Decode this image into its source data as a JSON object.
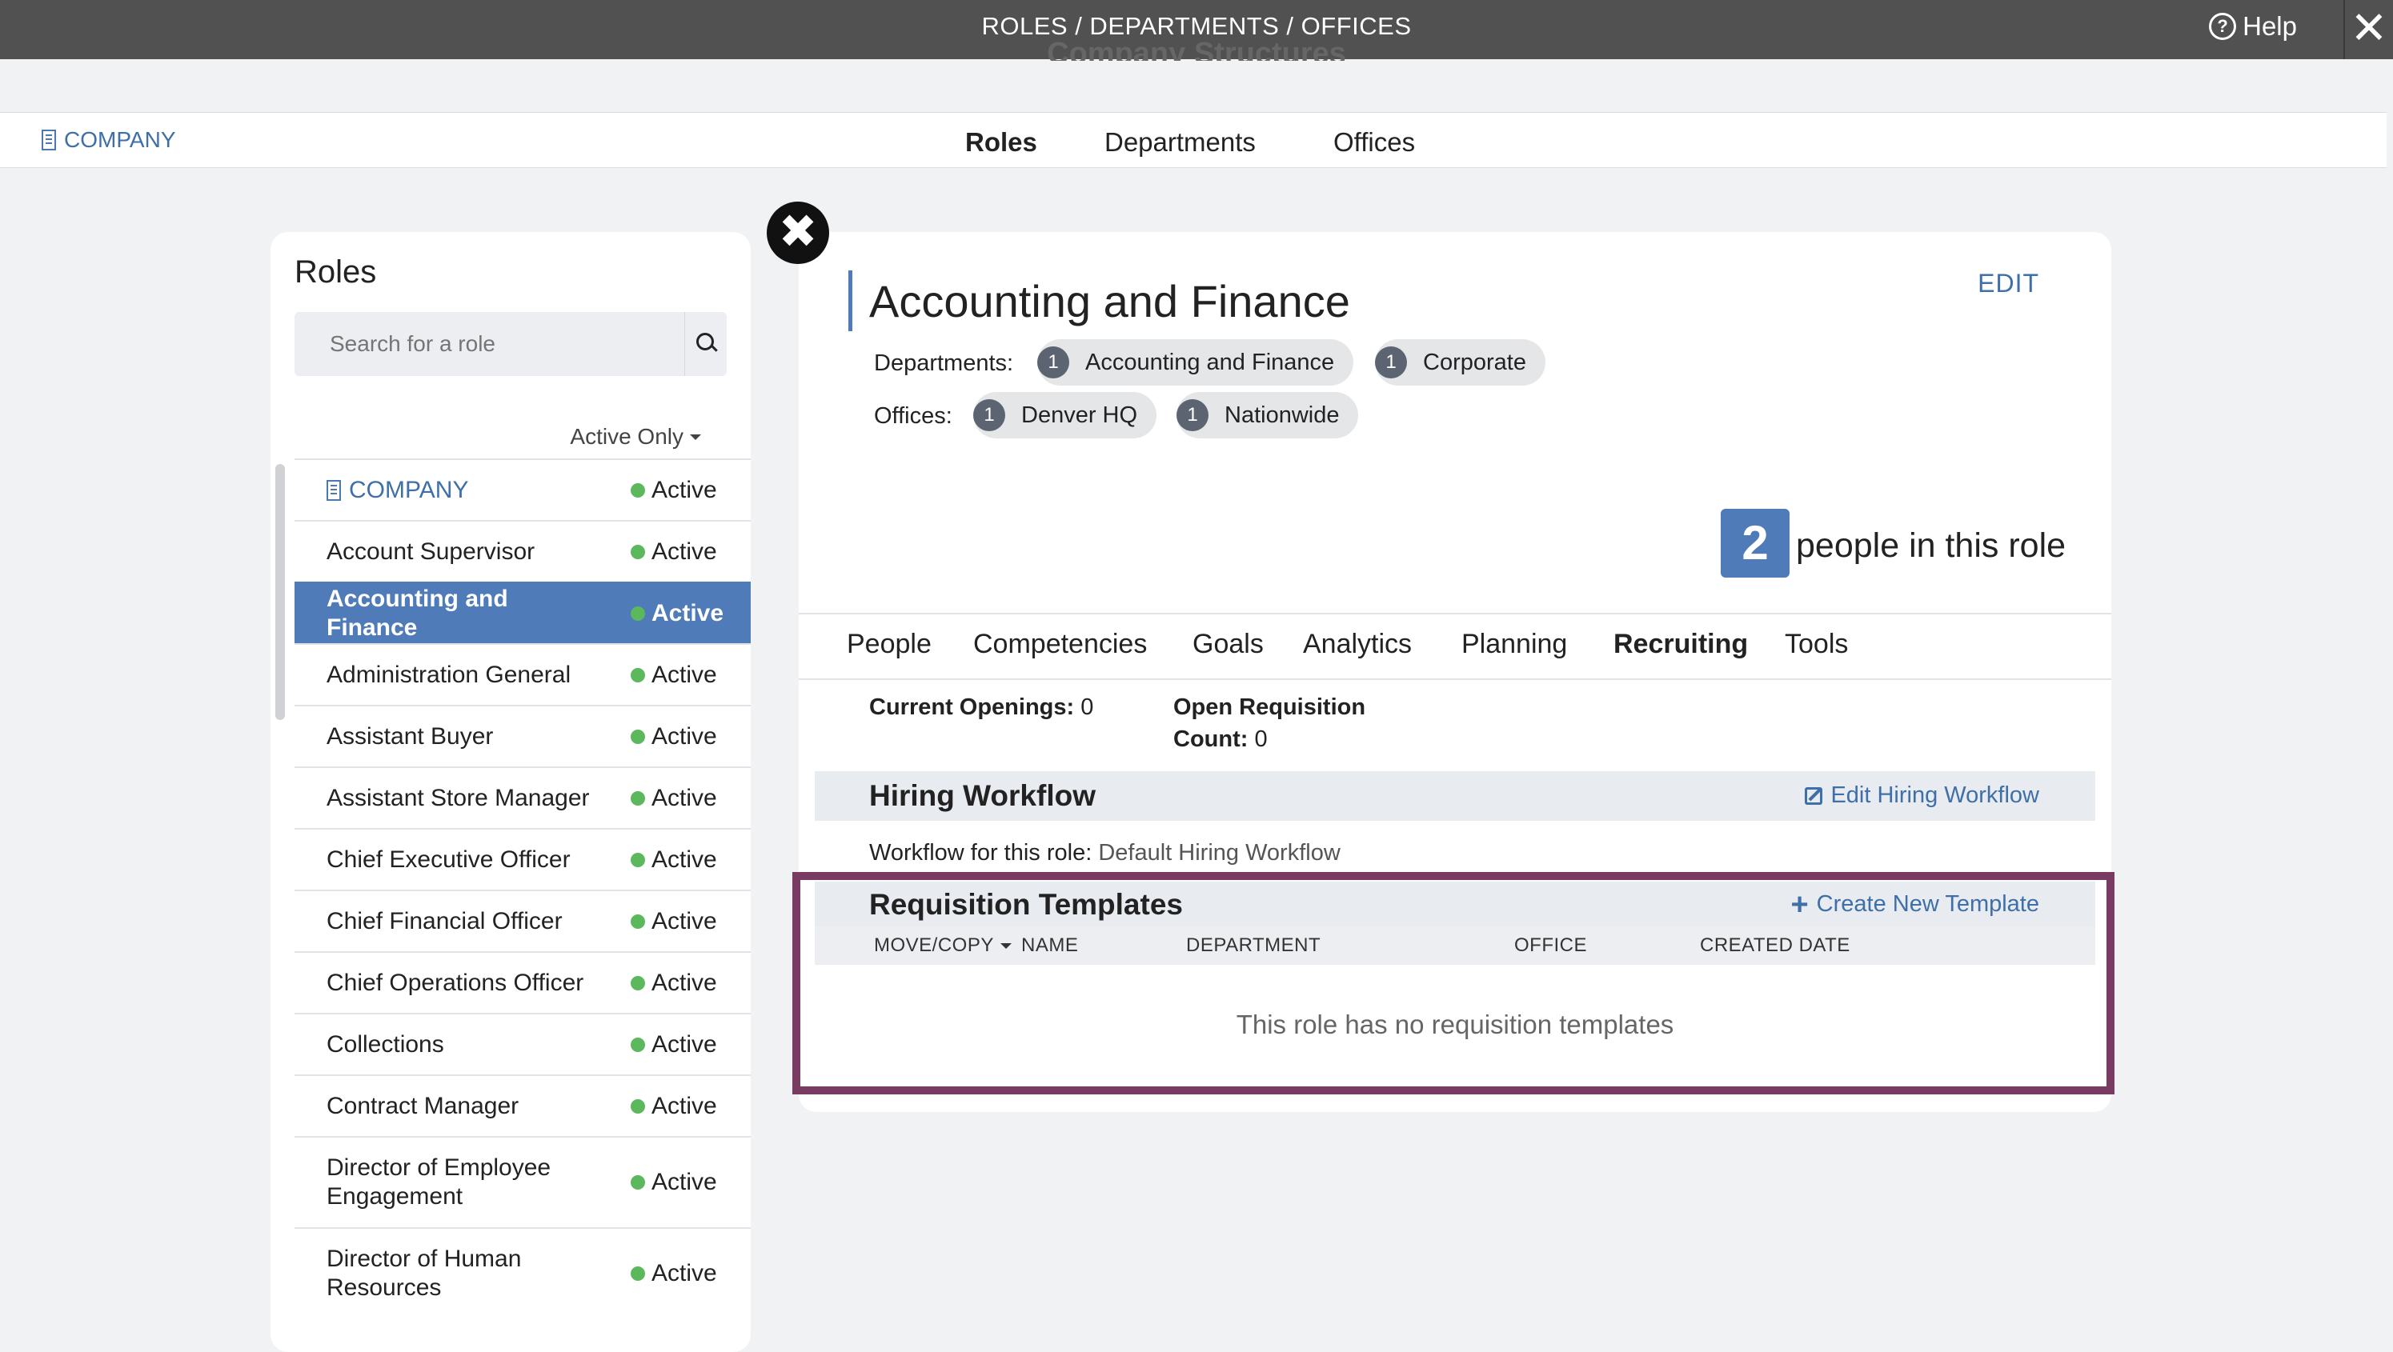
{
  "topbar": {
    "title": "ROLES / DEPARTMENTS / OFFICES",
    "help": "Help",
    "close": "✕"
  },
  "page": {
    "title": "Company Structures"
  },
  "nav": {
    "company": "COMPANY",
    "tabs": [
      {
        "label": "Roles",
        "active": true
      },
      {
        "label": "Departments"
      },
      {
        "label": "Offices"
      }
    ]
  },
  "roles": {
    "title": "Roles",
    "search_placeholder": "Search for a role",
    "filter": "Active Only",
    "items": [
      {
        "name": "COMPANY",
        "status": "Active"
      },
      {
        "name": "Account Supervisor",
        "status": "Active"
      },
      {
        "name": "Accounting and Finance",
        "status": "Active",
        "selected": true
      },
      {
        "name": "Administration General",
        "status": "Active"
      },
      {
        "name": "Assistant Buyer",
        "status": "Active"
      },
      {
        "name": "Assistant Store Manager",
        "status": "Active"
      },
      {
        "name": "Chief Executive Officer",
        "status": "Active"
      },
      {
        "name": "Chief Financial Officer",
        "status": "Active"
      },
      {
        "name": "Chief Operations Officer",
        "status": "Active"
      },
      {
        "name": "Collections",
        "status": "Active"
      },
      {
        "name": "Contract Manager",
        "status": "Active"
      },
      {
        "name": "Director of Employee Engagement",
        "status": "Active"
      },
      {
        "name": "Director of Human Resources",
        "status": "Active"
      }
    ]
  },
  "detail": {
    "title": "Accounting and Finance",
    "edit": "EDIT",
    "departments_label": "Departments:",
    "departments": [
      {
        "count": "1",
        "name": "Accounting and Finance"
      },
      {
        "count": "1",
        "name": "Corporate"
      }
    ],
    "offices_label": "Offices:",
    "offices": [
      {
        "count": "1",
        "name": "Denver HQ"
      },
      {
        "count": "1",
        "name": "Nationwide"
      }
    ],
    "people_count": "2",
    "people_text": "people in this role",
    "tabs": [
      "People",
      "Competencies",
      "Goals",
      "Analytics",
      "Planning",
      "Recruiting",
      "Tools"
    ],
    "active_tab": "Recruiting",
    "current_openings_label": "Current Openings:",
    "current_openings": "0",
    "open_req_label_1": "Open Requisition",
    "open_req_label_2": "Count:",
    "open_req_count": "0",
    "hiring_workflow": {
      "title": "Hiring Workflow",
      "link": "Edit Hiring Workflow",
      "line_label": "Workflow for this role:",
      "line_value": "Default Hiring Workflow"
    },
    "requisition": {
      "title": "Requisition Templates",
      "link": "Create New Template",
      "columns": [
        "MOVE/COPY",
        "NAME",
        "DEPARTMENT",
        "OFFICE",
        "CREATED DATE"
      ],
      "empty": "This role has no requisition templates"
    }
  },
  "colors": {
    "accent": "#4f7bb8",
    "highlight": "#7a3b63",
    "active_dot": "#5cb85c",
    "topbar": "#515151"
  }
}
